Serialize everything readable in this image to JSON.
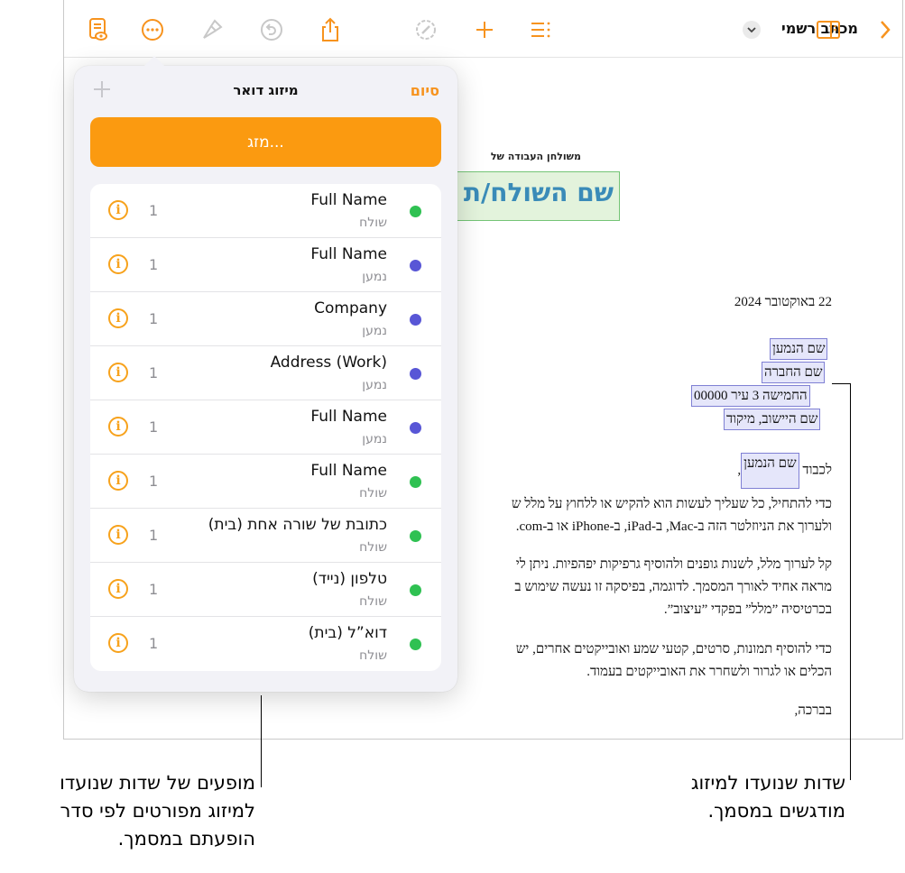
{
  "colors": {
    "accent": "#f7931e",
    "merge_button": "#fb9a10",
    "field_fill": "#e5e6fa",
    "field_border": "#7f80d4",
    "sender_field_fill": "#e3f3dc",
    "dot_green": "#2fc152",
    "dot_purple": "#5856d6"
  },
  "toolbar": {
    "icons": [
      "document-eye-icon",
      "more-icon",
      "format-brush-icon",
      "undo-icon",
      "share-icon",
      "edit-badge-icon",
      "add-icon",
      "list-icon",
      "sidebar-icon",
      "chevron-right-icon"
    ],
    "document_title": "מכתב רשמי"
  },
  "document": {
    "workspace_label": "משולחן העבודה של",
    "sender_name": "שם השולח/ת",
    "date": "22 באוקטובר 2024",
    "recipient_fields": [
      "שם הנמען",
      "שם החברה",
      "החמישה 3 עיר 00000",
      "שם היישוב, מיקוד"
    ],
    "greeting_prefix": "לכבוד",
    "greeting_field": "שם הנמען",
    "paragraphs": [
      [
        "כדי להתחיל, כל שעליך לעשות הוא להקיש או ללחוץ על מלל ש",
        "ולערוך את הניוזלטר הזה ב-Mac, ב-iPad, ב-iPhone או ב-com."
      ],
      [
        "קל לערוך מלל, לשנות גופנים ולהוסיף גרפיקות יפהפיות. ניתן לי",
        "מראה אחיד לאורך המסמך. לדוגמה, בפיסקה זו נעשה שימוש ב",
        "בכרטיסיה ”מלל” בפקדי ”עיצוב”."
      ],
      [
        "כדי להוסיף תמונות, סרטים, קטעי שמע ואובייקטים אחרים, יש ",
        "הכלים או לגרור ולשחרר את האובייקטים בעמוד."
      ]
    ],
    "closing": "בברכה,"
  },
  "popover": {
    "title": "מיזוג דואר",
    "done_label": "סיום",
    "merge_label": "מזג...",
    "rows": [
      {
        "name": "Full Name",
        "role": "שולח",
        "count": "1",
        "dot": "green"
      },
      {
        "name": "Full Name",
        "role": "נמען",
        "count": "1",
        "dot": "purple"
      },
      {
        "name": "Company",
        "role": "נמען",
        "count": "1",
        "dot": "purple"
      },
      {
        "name": "Address (Work)",
        "role": "נמען",
        "count": "1",
        "dot": "purple"
      },
      {
        "name": "Full Name",
        "role": "נמען",
        "count": "1",
        "dot": "purple"
      },
      {
        "name": "Full Name",
        "role": "שולח",
        "count": "1",
        "dot": "green"
      },
      {
        "name": "כתובת של שורה אחת (בית)",
        "role": "שולח",
        "count": "1",
        "dot": "green"
      },
      {
        "name": "טלפון (נייד)",
        "role": "שולח",
        "count": "1",
        "dot": "green"
      },
      {
        "name": "דוא”ל (בית)",
        "role": "שולח",
        "count": "1",
        "dot": "green"
      }
    ]
  },
  "callouts": {
    "left": [
      "מופעים של שדות שנועדו",
      "למיזוג מפורטים לפי סדר",
      "הופעתם במסמך."
    ],
    "right": [
      "שדות שנועדו למיזוג",
      "מודגשים במסמך."
    ]
  }
}
